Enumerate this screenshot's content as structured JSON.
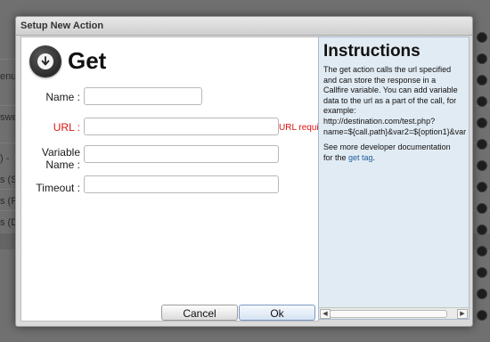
{
  "background": {
    "fragments": [
      "enu",
      "swe",
      ") - ",
      "s (S",
      "s (F",
      "s (D"
    ]
  },
  "dialog": {
    "title": "Setup New Action",
    "action_title": "Get",
    "fields": {
      "name_label": "Name :",
      "url_label": "URL :",
      "url_error": "URL required",
      "variable_label_line1": "Variable",
      "variable_label_line2": "Name :",
      "timeout_label": "Timeout :"
    },
    "values": {
      "name": "",
      "url": "",
      "variable": "",
      "timeout": ""
    },
    "buttons": {
      "cancel": "Cancel",
      "ok": "Ok"
    }
  },
  "instructions": {
    "title": "Instructions",
    "body": "The get action calls the url specified\nand can store the response in a\nCallfire variable. You can add variable\ndata to the url as a part of the call, for\nexample:\nhttp://destination.com/test.php?\nname=${call.path}&var2=${option1}&var",
    "more_prefix": "See more developer documentation\nfor the ",
    "link_text": "get tag",
    "more_suffix": "."
  },
  "icons": {
    "action_icon": "download-arrow-icon",
    "scroll_left": "left-arrow-icon",
    "scroll_right": "right-arrow-icon"
  },
  "colors": {
    "error": "#dd1111",
    "link": "#1a5a9c",
    "instructions_bg": "#e1ebf3"
  }
}
